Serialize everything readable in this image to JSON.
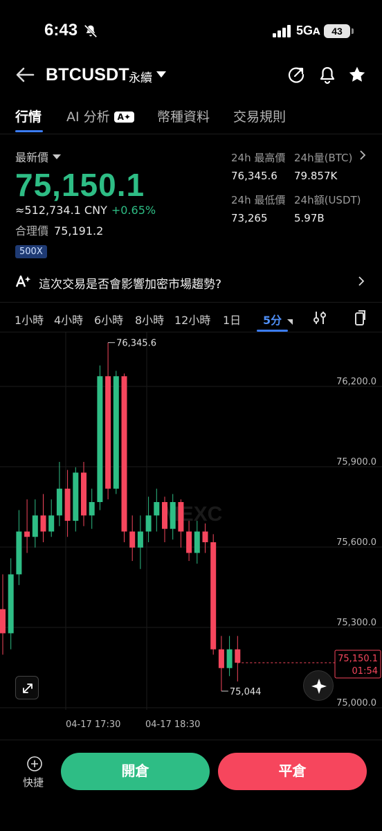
{
  "status_bar": {
    "time": "6:43",
    "network": "5Gᴀ",
    "battery": "43"
  },
  "header": {
    "symbol": "BTCUSDT",
    "contract_type": "永續"
  },
  "tabs": [
    "行情",
    "AI 分析",
    "幣種資料",
    "交易規則"
  ],
  "ai_badge": "A✦",
  "price": {
    "last_label": "最新價",
    "last": "75,150.1",
    "cny": "≈512,734.1 CNY",
    "change": "+0.65%",
    "fair_label": "合理價",
    "fair": "75,191.2",
    "leverage": "500X"
  },
  "stats": {
    "high_label": "24h 最高價",
    "high": "76,345.6",
    "vol_label": "24h量(BTC)",
    "vol": "79.857K",
    "low_label": "24h 最低價",
    "low": "73,265",
    "turnover_label": "24h額(USDT)",
    "turnover": "5.97B"
  },
  "ai_prompt": "這次交易是否會影響加密市場趨勢?",
  "intervals": [
    "1小時",
    "4小時",
    "6小時",
    "8小時",
    "12小時",
    "1日",
    "5分"
  ],
  "active_interval": "5分",
  "colors": {
    "up": "#2ebd85",
    "down": "#f6465d",
    "accent": "#3b7cf7"
  },
  "chart_data": {
    "type": "candlestick",
    "y_ticks": [
      "76,200.0",
      "75,900.0",
      "75,600.0",
      "75,300.0",
      "75,000.0"
    ],
    "y_tick_values": [
      76200,
      75900,
      75600,
      75300,
      75000
    ],
    "x_ticks": [
      "04-17 17:30",
      "04-17 18:30"
    ],
    "watermark": "MEXC",
    "high_marker": "76,345.6",
    "low_marker": "75,044",
    "current_price": "75,150.1",
    "countdown": "01:54",
    "candles": [
      {
        "o": 75350,
        "h": 75480,
        "l": 75180,
        "c": 75260
      },
      {
        "o": 75260,
        "h": 75540,
        "l": 75200,
        "c": 75480
      },
      {
        "o": 75480,
        "h": 75720,
        "l": 75440,
        "c": 75640
      },
      {
        "o": 75640,
        "h": 75760,
        "l": 75560,
        "c": 75620
      },
      {
        "o": 75620,
        "h": 75760,
        "l": 75580,
        "c": 75700
      },
      {
        "o": 75700,
        "h": 75780,
        "l": 75600,
        "c": 75640
      },
      {
        "o": 75640,
        "h": 75760,
        "l": 75620,
        "c": 75700
      },
      {
        "o": 75700,
        "h": 75900,
        "l": 75660,
        "c": 75800
      },
      {
        "o": 75800,
        "h": 75870,
        "l": 75620,
        "c": 75680
      },
      {
        "o": 75680,
        "h": 75880,
        "l": 75640,
        "c": 75860
      },
      {
        "o": 75860,
        "h": 75900,
        "l": 75660,
        "c": 75700
      },
      {
        "o": 75700,
        "h": 75800,
        "l": 75650,
        "c": 75750
      },
      {
        "o": 75750,
        "h": 76260,
        "l": 75720,
        "c": 76220
      },
      {
        "o": 76220,
        "h": 76345.6,
        "l": 75760,
        "c": 75800
      },
      {
        "o": 75800,
        "h": 76240,
        "l": 75780,
        "c": 76220
      },
      {
        "o": 76220,
        "h": 76230,
        "l": 75600,
        "c": 75640
      },
      {
        "o": 75640,
        "h": 75700,
        "l": 75530,
        "c": 75580
      },
      {
        "o": 75580,
        "h": 75700,
        "l": 75500,
        "c": 75640
      },
      {
        "o": 75640,
        "h": 75770,
        "l": 75600,
        "c": 75700
      },
      {
        "o": 75700,
        "h": 75800,
        "l": 75640,
        "c": 75750
      },
      {
        "o": 75750,
        "h": 75770,
        "l": 75600,
        "c": 75650
      },
      {
        "o": 75650,
        "h": 75780,
        "l": 75610,
        "c": 75750
      },
      {
        "o": 75750,
        "h": 75760,
        "l": 75580,
        "c": 75640
      },
      {
        "o": 75640,
        "h": 75680,
        "l": 75530,
        "c": 75560
      },
      {
        "o": 75560,
        "h": 75680,
        "l": 75520,
        "c": 75640
      },
      {
        "o": 75640,
        "h": 75670,
        "l": 75560,
        "c": 75600
      },
      {
        "o": 75600,
        "h": 75630,
        "l": 75180,
        "c": 75200
      },
      {
        "o": 75200,
        "h": 75250,
        "l": 75044,
        "c": 75130
      },
      {
        "o": 75130,
        "h": 75250,
        "l": 75100,
        "c": 75200
      },
      {
        "o": 75200,
        "h": 75250,
        "l": 75080,
        "c": 75150.1
      }
    ]
  },
  "bottom": {
    "quick_label": "快捷",
    "open_label": "開倉",
    "close_label": "平倉"
  }
}
